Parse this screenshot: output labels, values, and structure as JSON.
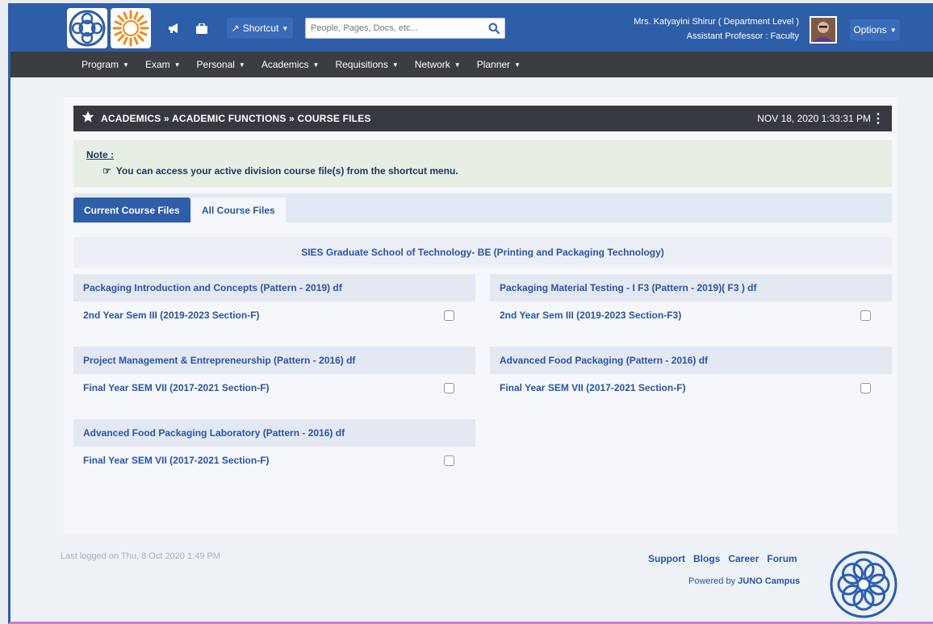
{
  "header": {
    "shortcut_label": "Shortcut",
    "search_placeholder": "People, Pages, Docs, etc...",
    "user_name": "Mrs. Katyayini Shirur ( Department Level )",
    "user_role": "Assistant Professor : Faculty",
    "options_label": "Options",
    "colors": {
      "brand": "#2e5ea8",
      "menubar": "#3a3d42"
    }
  },
  "menu": {
    "items": [
      "Program",
      "Exam",
      "Personal",
      "Academics",
      "Requisitions",
      "Network",
      "Planner"
    ]
  },
  "titlebar": {
    "breadcrumb": "ACADEMICS » ACADEMIC FUNCTIONS » COURSE FILES",
    "datetime": "NOV 18, 2020  1:33:31 PM"
  },
  "note": {
    "title": "Note :",
    "text": "You can access your active division course file(s) from the shortcut menu."
  },
  "tabs": {
    "current": "Current Course Files",
    "all": "All Course Files"
  },
  "school": "SIES Graduate School of Technology- BE (Printing and Packaging Technology)",
  "courses": [
    {
      "title": "Packaging Introduction and Concepts (Pattern - 2019) df",
      "section": "2nd Year Sem III (2019-2023 Section-F)"
    },
    {
      "title": "Packaging Material Testing - I F3 (Pattern - 2019)( F3 ) df",
      "section": "2nd Year Sem III (2019-2023 Section-F3)"
    },
    {
      "title": "Project Management & Entrepreneurship (Pattern - 2016) df",
      "section": "Final Year SEM VII (2017-2021 Section-F)"
    },
    {
      "title": "Advanced Food Packaging (Pattern - 2016) df",
      "section": "Final Year SEM VII (2017-2021 Section-F)"
    },
    {
      "title": "Advanced Food Packaging Laboratory (Pattern - 2016) df",
      "section": "Final Year SEM VII (2017-2021 Section-F)"
    }
  ],
  "footer": {
    "last_login": "Last logged on Thu, 8 Oct 2020 1:49 PM",
    "links": [
      "Support",
      "Blogs",
      "Career",
      "Forum"
    ],
    "powered_prefix": "Powered by ",
    "powered_brand": "JUNO Campus"
  }
}
